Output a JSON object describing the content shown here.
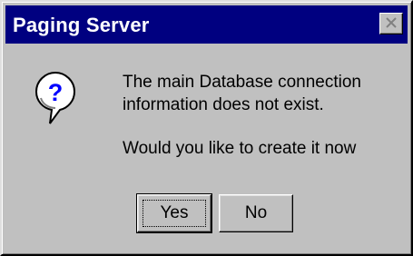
{
  "window": {
    "title": "Paging Server",
    "close_icon": "close-icon"
  },
  "dialog": {
    "icon": "question-icon",
    "message_line1": "The main Database connection",
    "message_line2": "information does not exist.",
    "question": "Would you like to create it now"
  },
  "buttons": {
    "yes_label": "Yes",
    "no_label": "No"
  },
  "colors": {
    "titlebar": "#000080",
    "face": "#c0c0c0",
    "icon_fill": "#ffffff",
    "icon_glyph": "#0000ff"
  }
}
